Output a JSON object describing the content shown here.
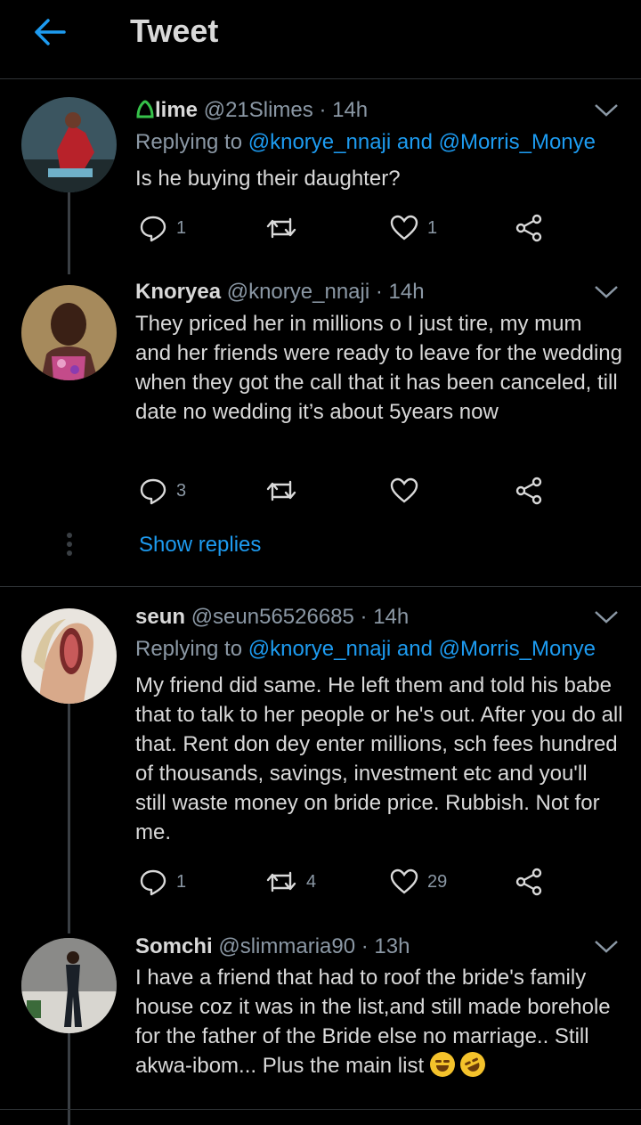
{
  "header": {
    "title": "Tweet"
  },
  "tweets": [
    {
      "display_name": "lime",
      "handle": "@21Slimes",
      "time": "· 14h",
      "replying_label": "Replying to",
      "mentions": "@knorye_nnaji and @Morris_Monye",
      "text": "Is he buying their daughter?",
      "replies": "1",
      "retweets": "",
      "likes": "1"
    },
    {
      "display_name": "Knoryea",
      "handle": "@knorye_nnaji",
      "time": "· 14h",
      "text": "They priced her in millions o I just tire, my mum and her friends were ready to leave for the wedding when they got the call that it has been canceled, till date no wedding it’s about 5years now",
      "replies": "3",
      "retweets": "",
      "likes": "",
      "show_replies": "Show replies"
    },
    {
      "display_name": "seun",
      "handle": "@seun56526685",
      "time": "· 14h",
      "replying_label": "Replying to",
      "mentions": "@knorye_nnaji and @Morris_Monye",
      "text": "My friend did same. He left them and told his babe that to talk to her people or he's out. After you do all that. Rent don dey enter millions, sch fees hundred of thousands, savings, investment etc and you'll still waste money on bride price. Rubbish. Not for me.",
      "replies": "1",
      "retweets": "4",
      "likes": "29"
    },
    {
      "display_name": "Somchi",
      "handle": "@slimmaria90",
      "time": "· 13h",
      "text": "I have a friend that had to roof the bride's family house coz it was in the list,and still made borehole for the father of the Bride else no marriage.. Still akwa-ibom... Plus the main list"
    }
  ],
  "colors": {
    "accent": "#1d9bf0",
    "background": "#000000",
    "muted": "#8b98a5"
  }
}
